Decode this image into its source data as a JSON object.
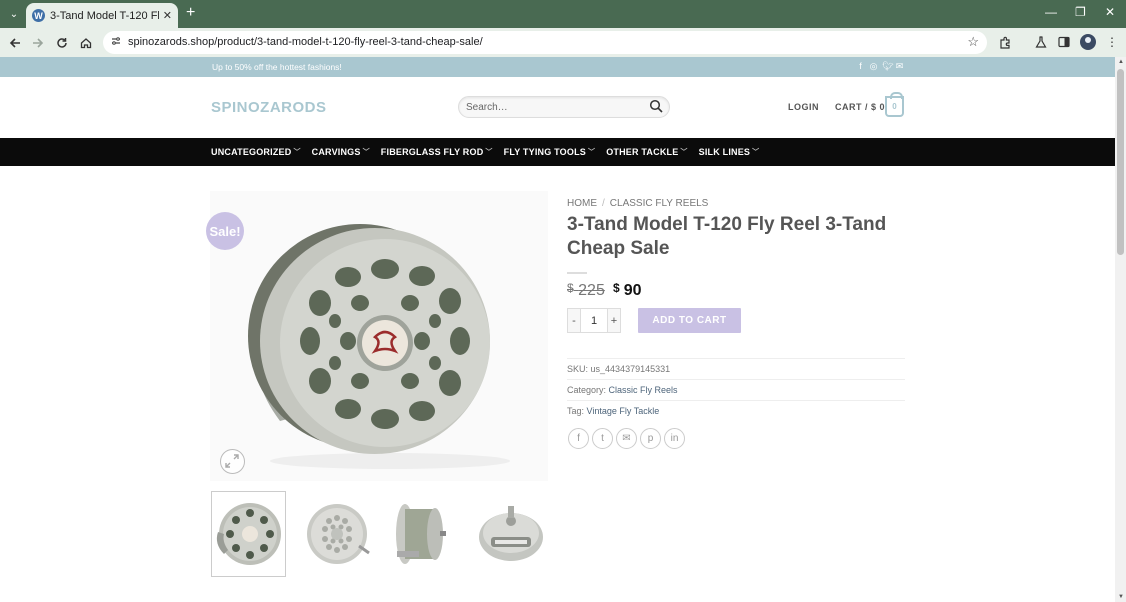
{
  "browser": {
    "tab_title": "3-Tand Model T-120 Fly Reel 3-",
    "tab_favicon": "W",
    "tab_close": "✕",
    "new_tab": "+",
    "url": "spinozarods.shop/product/3-tand-model-t-120-fly-reel-3-tand-cheap-sale/",
    "controls": {
      "minimize": "—",
      "restore": "❐",
      "close": "✕"
    },
    "icons": [
      "back-icon",
      "forward-icon",
      "reload-icon",
      "home-icon",
      "site-info-icon",
      "bookmark-star-icon",
      "extensions-icon",
      "labs-icon",
      "side-panel-icon",
      "profile-icon",
      "more-icon"
    ]
  },
  "site": {
    "promo": "Up to 50% off the hottest fashions!",
    "logo": "SPINOZARODS",
    "search_placeholder": "Search…",
    "login": "LOGIN",
    "cart_label": "CART / $ 0",
    "cart_count": "0",
    "accent_color": "#A9C7D0",
    "button_color": "#C9C1E4",
    "nav": [
      {
        "label": "UNCATEGORIZED"
      },
      {
        "label": "CARVINGS"
      },
      {
        "label": "FIBERGLASS FLY ROD"
      },
      {
        "label": "FLY TYING TOOLS"
      },
      {
        "label": "OTHER TACKLE"
      },
      {
        "label": "SILK LINES"
      }
    ]
  },
  "product": {
    "sale_badge": "Sale!",
    "breadcrumb": {
      "home": "HOME",
      "separator": "/",
      "category": "CLASSIC FLY REELS"
    },
    "title": "3-Tand Model T-120 Fly Reel 3-Tand Cheap Sale",
    "price_old_currency": "$",
    "price_old": "225",
    "price_new_currency": "$",
    "price_new": "90",
    "qty_minus": "-",
    "qty_value": "1",
    "qty_plus": "+",
    "add_to_cart": "ADD TO CART",
    "sku_label": "SKU:",
    "sku_value": "us_4434379145331",
    "category_label": "Category:",
    "category_value": "Classic Fly Reels",
    "tag_label": "Tag:",
    "tag_value": "Vintage Fly Tackle",
    "share": [
      {
        "icon": "facebook-icon",
        "glyph": "f"
      },
      {
        "icon": "twitter-icon",
        "glyph": "t"
      },
      {
        "icon": "email-icon",
        "glyph": "✉"
      },
      {
        "icon": "pinterest-icon",
        "glyph": "p"
      },
      {
        "icon": "linkedin-icon",
        "glyph": "in"
      }
    ],
    "thumbnails": [
      "reel-front-dark",
      "reel-front-light",
      "reel-side",
      "reel-back"
    ]
  }
}
